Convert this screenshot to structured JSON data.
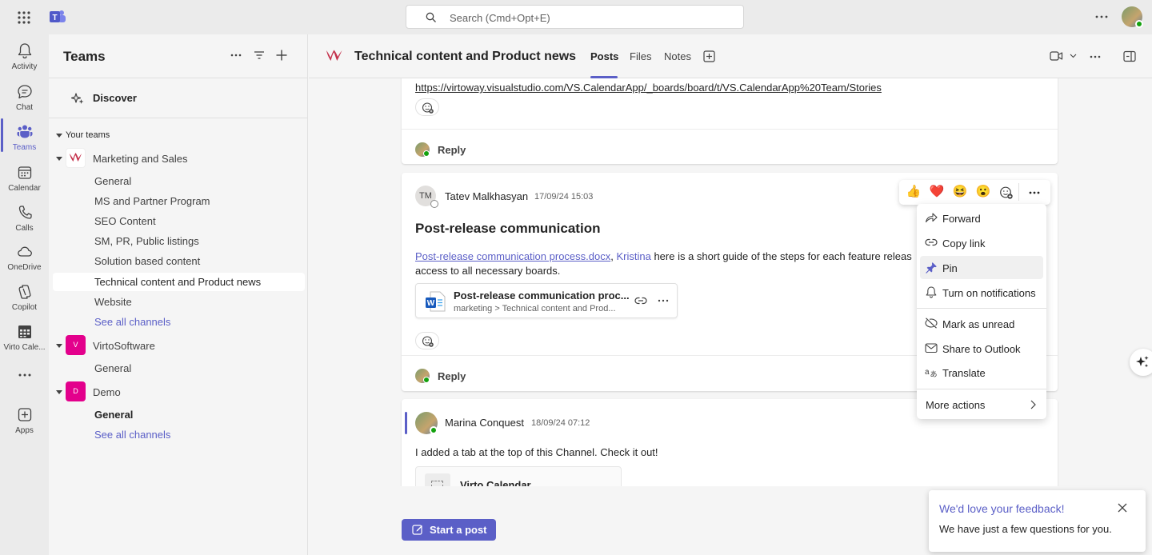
{
  "topbar": {
    "search_placeholder": "Search (Cmd+Opt+E)",
    "apps_icon": "waffle-icon",
    "more_icon": "more-horizontal-icon"
  },
  "rail": {
    "items": [
      {
        "label": "Activity",
        "icon": "bell-icon"
      },
      {
        "label": "Chat",
        "icon": "chat-icon"
      },
      {
        "label": "Teams",
        "icon": "teams-icon",
        "active": true
      },
      {
        "label": "Calendar",
        "icon": "calendar-icon"
      },
      {
        "label": "Calls",
        "icon": "phone-icon"
      },
      {
        "label": "OneDrive",
        "icon": "cloud-icon"
      },
      {
        "label": "Copilot",
        "icon": "copilot-icon"
      },
      {
        "label": "Virto Cale...",
        "icon": "grid-calendar-icon"
      },
      {
        "label": "",
        "icon": "more-horizontal-icon"
      },
      {
        "label": "Apps",
        "icon": "add-apps-icon"
      }
    ]
  },
  "panel": {
    "title": "Teams",
    "discover_label": "Discover",
    "your_teams_label": "Your teams",
    "teams": [
      {
        "name": "Marketing and Sales",
        "channels": [
          "General",
          "MS and Partner Program",
          "SEO Content",
          "SM, PR, Public listings",
          "Solution based content",
          "Technical content and Product news",
          "Website"
        ],
        "see_all": "See all channels"
      },
      {
        "name": "VirtoSoftware",
        "badge": "V",
        "badge_color": "#e3008c",
        "channels": [
          "General"
        ]
      },
      {
        "name": "Demo",
        "badge": "D",
        "badge_color": "#e3008c",
        "channels": [
          "General"
        ],
        "see_all": "See all channels"
      }
    ]
  },
  "channel_header": {
    "title": "Technical content and Product news",
    "tabs": [
      "Posts",
      "Files",
      "Notes"
    ],
    "active_tab": "Posts"
  },
  "posts": {
    "first": {
      "link": "https://virtoway.visualstudio.com/VS.CalendarApp/_boards/board/t/VS.CalendarApp%20Team/Stories",
      "reply_label": "Reply"
    },
    "second": {
      "avatar_initials": "TM",
      "author": "Tatev Malkhasyan",
      "time": "17/09/24 15:03",
      "title": "Post-release communication",
      "body_link": "Post-release communication process.docx",
      "body_sep": ", ",
      "mention": "Kristina",
      "body_rest": " here is a short guide of the steps for each feature releas",
      "body_line2": "access to all necessary boards.",
      "file_name": "Post-release communication proc...",
      "file_path": "marketing > Technical content and Prod...",
      "reply_label": "Reply"
    },
    "third": {
      "author": "Marina Conquest",
      "time": "18/09/24 07:12",
      "body": "I added a tab at the top of this Channel. Check it out!",
      "card_title": "Virto Calendar"
    }
  },
  "reactions": [
    "👍",
    "❤️",
    "😆",
    "😮"
  ],
  "context_menu": {
    "items": [
      {
        "label": "Forward",
        "icon": "forward-icon"
      },
      {
        "label": "Copy link",
        "icon": "link-icon"
      },
      {
        "label": "Pin",
        "icon": "pin-icon",
        "highlighted": true
      },
      {
        "label": "Turn on notifications",
        "icon": "bell-icon"
      },
      {
        "label": "Mark as unread",
        "icon": "mark-unread-icon"
      },
      {
        "label": "Share to Outlook",
        "icon": "mail-icon"
      },
      {
        "label": "Translate",
        "icon": "translate-icon"
      },
      {
        "label": "More actions",
        "icon": "chevron-right-icon"
      }
    ]
  },
  "start_post_label": "Start a post",
  "feedback": {
    "title": "We'd love your feedback!",
    "text": "We have just a few questions for you."
  },
  "colors": {
    "accent": "#5b5fc7",
    "presence_available": "#13a10e",
    "team_badge": "#e3008c",
    "brand_logo": "#c4314b"
  }
}
